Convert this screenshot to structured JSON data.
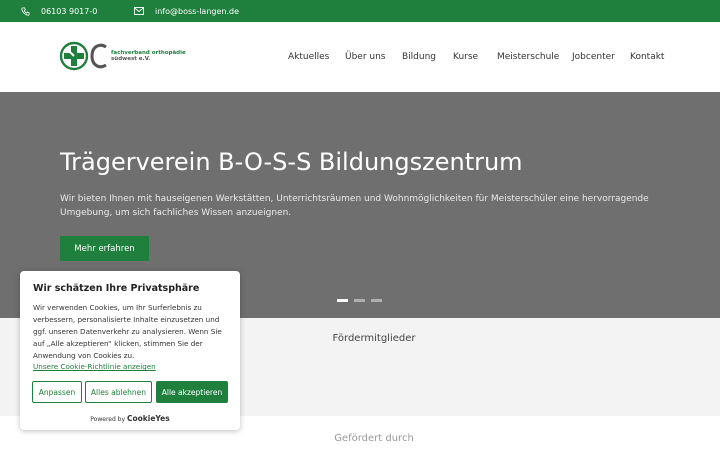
{
  "topbar": {
    "phone": "06103 9017-0",
    "email": "info@boss-langen.de",
    "phone_icon": "phone-icon",
    "mail_icon": "mail-icon"
  },
  "logo": {
    "line1": "fachverband orthopädie",
    "line2": "südwest e.V."
  },
  "nav": {
    "items": [
      "Aktuelles",
      "Über uns",
      "Bildung",
      "Kurse",
      "Meisterschule",
      "Jobcenter",
      "Kontakt"
    ]
  },
  "hero": {
    "title": "Trägerverein B-O-S-S Bildungszentrum",
    "text": "Wir bieten Ihnen mit hauseigenen Werkstätten, Unterrichtsräumen und Wohnmöglichkeiten für Meisterschüler eine hervorragende Umgebung, um sich fachliches Wissen anzueignen.",
    "cta": "Mehr erfahren",
    "slides": 3,
    "active_slide": 1
  },
  "sections": {
    "members": "Fördermitglieder",
    "funded": "Gefördert durch"
  },
  "cookie": {
    "title": "Wir schätzen Ihre Privatsphäre",
    "body": "Wir verwenden Cookies, um Ihr Surferlebnis zu verbessern, personalisierte Inhalte einzusetzen und ggf. unseren Datenverkehr zu analysieren. Wenn Sie auf „Alle akzeptieren“ klicken, stimmen Sie der Anwendung von Cookies zu.",
    "policy_link": "Unsere Cookie-Richtlinie anzeigen",
    "customize": "Anpassen",
    "reject": "Alles ablehnen",
    "accept": "Alle akzeptieren",
    "powered_by": "Powered by",
    "brand": "CookieYes"
  },
  "colors": {
    "brand_green": "#1f7f3d",
    "hero_gray": "#6f6f6f"
  }
}
